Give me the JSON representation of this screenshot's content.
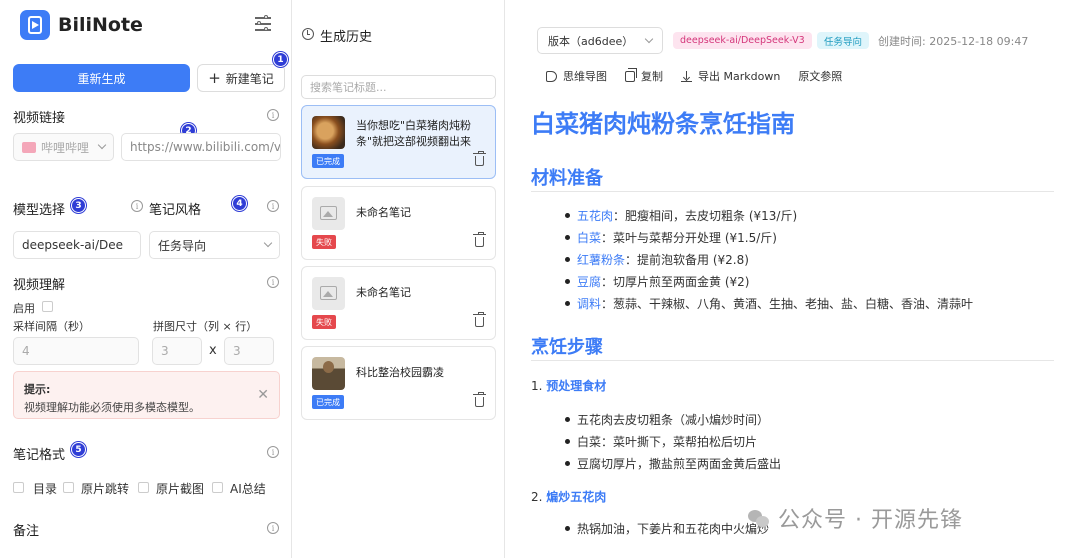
{
  "app": {
    "name": "BiliNote"
  },
  "left": {
    "regenerate_label": "重新生成",
    "new_note_label": "新建笔记",
    "video_link_label": "视频链接",
    "platform_value": "哔哩哔哩",
    "url_placeholder": "https://www.bilibili.com/vi",
    "model_label": "模型选择",
    "style_label": "笔记风格",
    "model_value": "deepseek-ai/Dee",
    "style_value": "任务导向",
    "video_understand_label": "视频理解",
    "enable_label": "启用",
    "interval_label": "采样间隔（秒）",
    "interval_value": "4",
    "grid_label": "拼图尺寸（列 × 行）",
    "grid_cols": "3",
    "grid_x": "x",
    "grid_rows": "3",
    "hint_title": "提示:",
    "hint_text": "视频理解功能必须使用多模态模型。",
    "note_format_label": "笔记格式",
    "formats": [
      "目录",
      "原片跳转",
      "原片截图",
      "AI总结"
    ],
    "remark_label": "备注",
    "badges": [
      "1",
      "2",
      "3",
      "4",
      "5"
    ]
  },
  "history": {
    "title": "生成历史",
    "search_placeholder": "搜索笔记标题...",
    "items": [
      {
        "title": "当你想吃\"白菜猪肉炖粉条\"就把这部视频翻出来",
        "status": "已完成"
      },
      {
        "title": "未命名笔记",
        "status": "失败"
      },
      {
        "title": "未命名笔记",
        "status": "失败"
      },
      {
        "title": "科比整治校园霸凌",
        "status": "已完成"
      }
    ]
  },
  "note": {
    "version_label": "版本（ad6dee）",
    "model_tag": "deepseek-ai/DeepSeek-V3",
    "style_tag": "任务导向",
    "created": "创建时间: 2025-12-18 09:47",
    "toolbar": {
      "mindmap": "思维导图",
      "copy": "复制",
      "export": "导出 Markdown",
      "source": "原文参照"
    },
    "title": "白菜猪肉炖粉条烹饪指南",
    "section1": "材料准备",
    "ingredients": [
      {
        "k": "五花肉",
        "v": "：肥瘦相间，去皮切粗条 (¥13/斤)"
      },
      {
        "k": "白菜",
        "v": "：菜叶与菜帮分开处理 (¥1.5/斤)"
      },
      {
        "k": "红薯粉条",
        "v": "：提前泡软备用 (¥2.8)"
      },
      {
        "k": "豆腐",
        "v": "：切厚片煎至两面金黄 (¥2)"
      },
      {
        "k": "调料",
        "v": "：葱蒜、干辣椒、八角、黄酒、生抽、老抽、盐、白糖、香油、清蒜叶"
      }
    ],
    "section2": "烹饪步骤",
    "step1_num": "1.",
    "step1": "预处理食材",
    "step1_items": [
      "五花肉去皮切粗条（减小煸炒时间）",
      "白菜：菜叶撕下，菜帮拍松后切片",
      "豆腐切厚片，撒盐煎至两面金黄后盛出"
    ],
    "step2_num": "2.",
    "step2": "煸炒五花肉",
    "step2_item": "热锅加油，下姜片和五花肉中火煸炒"
  },
  "watermark": "公众号 · 开源先锋",
  "colors": {
    "accent": "#3d7cf6",
    "fail": "#e5484d",
    "badge": "#2f3dd6"
  }
}
